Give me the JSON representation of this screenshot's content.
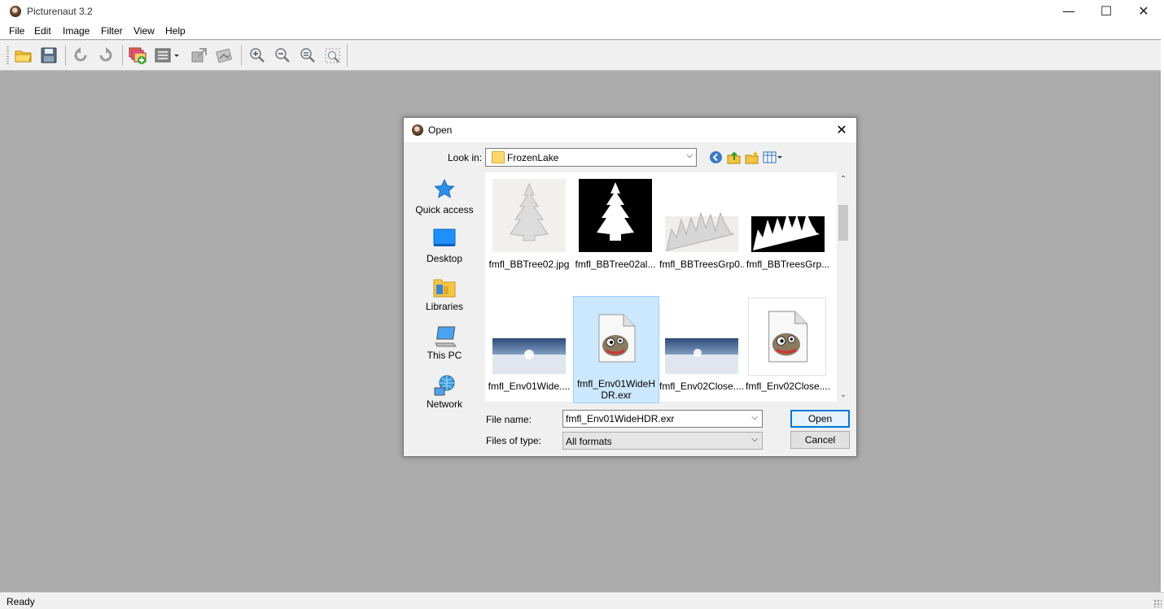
{
  "window": {
    "title": "Picturenaut 3.2",
    "minimize": "—",
    "maximize": "☐",
    "close": "✕"
  },
  "menu": [
    "File",
    "Edit",
    "Image",
    "Filter",
    "View",
    "Help"
  ],
  "toolbar": {
    "icons": [
      "open-folder-icon",
      "save-icon",
      "undo-icon",
      "redo-icon",
      "generate-hdr-icon",
      "layers-dropdown-icon",
      "transform-icon",
      "tonemap-icon",
      "zoom-in-icon",
      "zoom-out-icon",
      "zoom-reset-icon",
      "zoom-fit-icon"
    ]
  },
  "status": {
    "text": "Ready"
  },
  "dialog": {
    "title": "Open",
    "close": "✕",
    "look_in_label": "Look in:",
    "look_in_value": "FrozenLake",
    "places": [
      "Quick access",
      "Desktop",
      "Libraries",
      "This PC",
      "Network"
    ],
    "files": [
      {
        "name": "fmfl_BBTree02.jpg",
        "thumb": "tree-light"
      },
      {
        "name": "fmfl_BBTree02al...",
        "thumb": "tree-dark"
      },
      {
        "name": "fmfl_BBTreesGrp0...",
        "thumb": "trees-light"
      },
      {
        "name": "fmfl_BBTreesGrp...",
        "thumb": "trees-dark"
      },
      {
        "name": "fmfl_Env01Wide....",
        "thumb": "panorama"
      },
      {
        "name": "fmfl_Env01WideHDR.exr",
        "name_line1": "fmfl_Env01WideH",
        "name_line2": "DR.exr",
        "thumb": "gimp-file",
        "selected": true
      },
      {
        "name": "fmfl_Env02Close....",
        "thumb": "panorama"
      },
      {
        "name": "fmfl_Env02Close....",
        "thumb": "gimp-file"
      }
    ],
    "file_name_label": "File name:",
    "file_name_value": "fmfl_Env01WideHDR.exr",
    "file_type_label": "Files of type:",
    "file_type_value": "All formats",
    "open_label": "Open",
    "cancel_label": "Cancel"
  },
  "colors": {
    "workspace": "#ababab",
    "selection": "#cce8ff",
    "accent": "#0078d7"
  }
}
